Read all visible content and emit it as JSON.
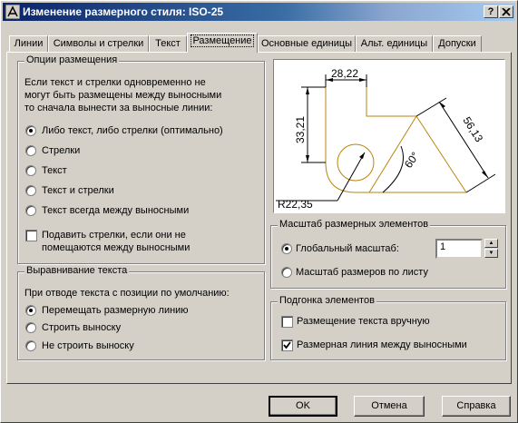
{
  "window": {
    "title": "Изменение размерного стиля: ISO-25",
    "help_btn": "?",
    "close_btn": "X"
  },
  "tabs": [
    "Линии",
    "Символы и стрелки",
    "Текст",
    "Размещение",
    "Основные единицы",
    "Альт. единицы",
    "Допуски"
  ],
  "active_tab": "Размещение",
  "fit_options": {
    "title": "Опции размещения",
    "description_lines": [
      "Если текст и стрелки одновременно не",
      "могут быть размещены между выносными",
      "то сначала вынести за выносные линии:"
    ],
    "options": [
      {
        "label": "Либо текст, либо стрелки (оптимально)",
        "checked": true
      },
      {
        "label": "Стрелки",
        "checked": false
      },
      {
        "label": "Текст",
        "checked": false
      },
      {
        "label": "Текст и стрелки",
        "checked": false
      },
      {
        "label": "Текст всегда между выносными",
        "checked": false
      }
    ],
    "suppress_label_lines": [
      "Подавить стрелки, если они не",
      "помещаются между выносными"
    ],
    "suppress_checked": false
  },
  "text_placement": {
    "title": "Выравнивание текста",
    "description": "При отводе текста с позиции по умолчанию:",
    "options": [
      {
        "label": "Перемещать размерную линию",
        "checked": true
      },
      {
        "label": "Строить выноску",
        "checked": false
      },
      {
        "label": "Не строить выноску",
        "checked": false
      }
    ]
  },
  "preview": {
    "dim_top": "28,22",
    "dim_left": "33,21",
    "dim_diag": "56,13",
    "dim_angle": "60°",
    "dim_radius": "R22,35"
  },
  "scale": {
    "title": "Масштаб размерных элементов",
    "global_label": "Глобальный масштаб:",
    "global_checked": true,
    "global_value": "1",
    "layout_label": "Масштаб размеров по листу",
    "layout_checked": false
  },
  "fine_tuning": {
    "title": "Подгонка элементов",
    "manual_label": "Размещение текста вручную",
    "manual_checked": false,
    "dimline_label": "Размерная линия между выносными",
    "dimline_checked": true
  },
  "buttons": {
    "ok": "OK",
    "cancel": "Отмена",
    "help": "Справка"
  },
  "colors": {
    "title_bar_start": "#0a246a",
    "dialog_bg": "#d4d0c8",
    "preview_geometry": "#b8860b"
  }
}
